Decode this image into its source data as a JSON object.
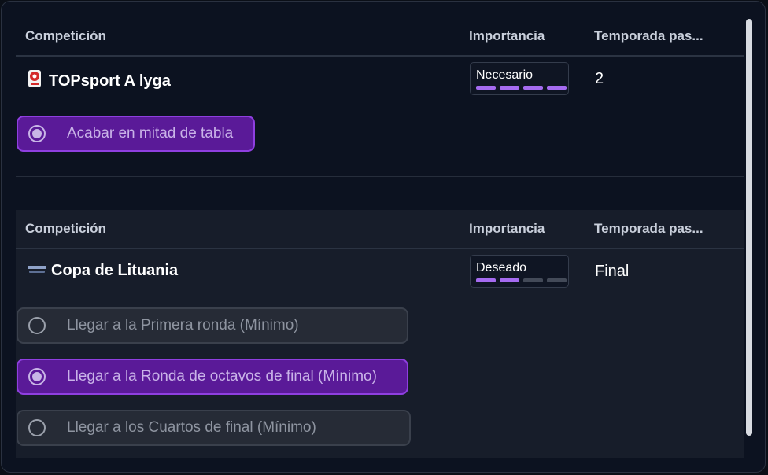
{
  "headers": {
    "competition": "Competición",
    "importance": "Importancia",
    "previous_season": "Temporada pas..."
  },
  "competitions": [
    {
      "name": "TOPsport A lyga",
      "icon": "league-badge-icon",
      "importance": {
        "label": "Necesario",
        "level": 4,
        "max": 4
      },
      "previous_season": "2",
      "objectives": [
        {
          "label": "Acabar en mitad de tabla",
          "selected": true
        }
      ]
    },
    {
      "name": "Copa de Lituania",
      "icon": "cup-logo-icon",
      "importance": {
        "label": "Deseado",
        "level": 2,
        "max": 4
      },
      "previous_season": "Final",
      "objectives": [
        {
          "label": "Llegar a la Primera ronda (Mínimo)",
          "selected": false
        },
        {
          "label": "Llegar a la Ronda de octavos de final (Mínimo)",
          "selected": true
        },
        {
          "label": "Llegar a los Cuartos de final (Mínimo)",
          "selected": false
        }
      ]
    }
  ],
  "colors": {
    "accent": "#a56bf0",
    "selected_bg": "#5a1a98",
    "panel_bg": "#0c1220"
  }
}
